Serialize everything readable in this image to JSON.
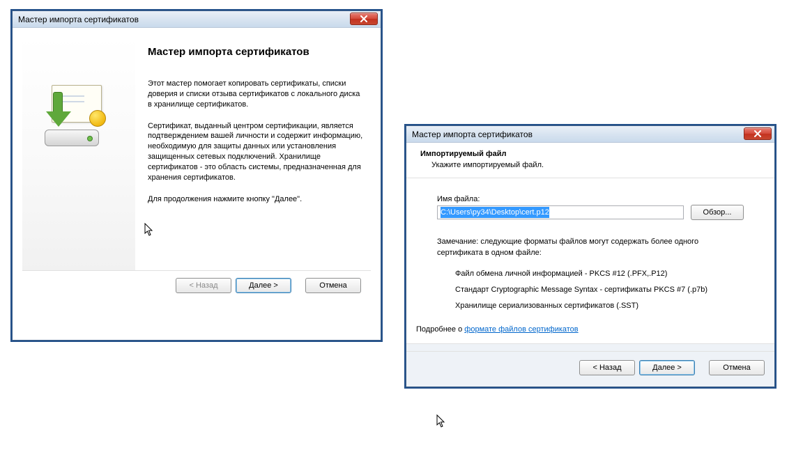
{
  "dlg1": {
    "title": "Мастер импорта сертификатов",
    "heading": "Мастер импорта сертификатов",
    "para1": "Этот мастер помогает копировать сертификаты, списки доверия и списки отзыва сертификатов с локального диска в хранилище сертификатов.",
    "para2": "Сертификат, выданный центром сертификации, является подтверждением вашей личности и содержит информацию, необходимую для защиты данных или установления защищенных сетевых подключений. Хранилище сертификатов - это область системы, предназначенная для хранения сертификатов.",
    "para3": "Для продолжения нажмите кнопку \"Далее\".",
    "btn_back": "< Назад",
    "btn_next": "Далее >",
    "btn_cancel": "Отмена"
  },
  "dlg2": {
    "title": "Мастер импорта сертификатов",
    "section_title": "Импортируемый файл",
    "section_sub": "Укажите импортируемый файл.",
    "filename_label": "Имя файла:",
    "filename_value": "C:\\Users\\py34\\Desktop\\cert.p12",
    "browse": "Обзор...",
    "note": "Замечание: следующие форматы файлов могут содержать более одного сертификата в одном файле:",
    "fmt1": "Файл обмена личной информацией - PKCS #12 (.PFX,.P12)",
    "fmt2": "Стандарт Cryptographic Message Syntax - сертификаты PKCS #7 (.p7b)",
    "fmt3": "Хранилище сериализованных сертификатов (.SST)",
    "learn_prefix": "Подробнее о ",
    "learn_link": "формате файлов сертификатов",
    "btn_back": "< Назад",
    "btn_next": "Далее >",
    "btn_cancel": "Отмена"
  }
}
